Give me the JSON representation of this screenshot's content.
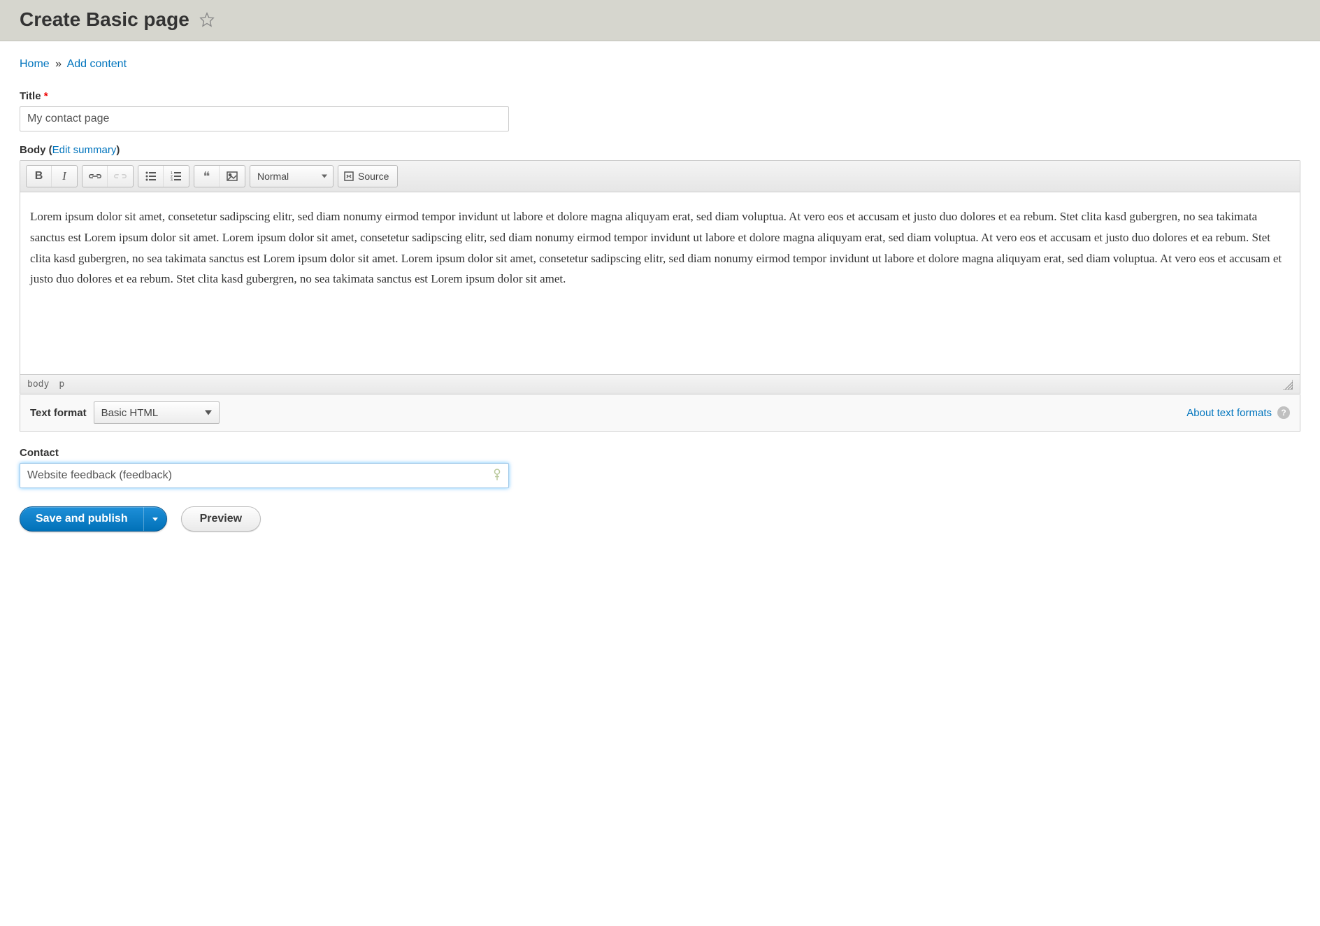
{
  "header": {
    "title": "Create Basic page"
  },
  "breadcrumb": {
    "home": "Home",
    "sep": "»",
    "add_content": "Add content"
  },
  "form": {
    "title_label": "Title",
    "required_marker": "*",
    "title_value": "My contact page",
    "body_label": "Body (",
    "edit_summary": "Edit summary",
    "body_label_close": ")",
    "contact_label": "Contact",
    "contact_value": "Website feedback (feedback)"
  },
  "toolbar": {
    "bold": "B",
    "italic": "I",
    "format_select": "Normal",
    "source": "Source"
  },
  "editor": {
    "body_text": "Lorem ipsum dolor sit amet, consetetur sadipscing elitr, sed diam nonumy eirmod tempor invidunt ut labore et dolore magna aliquyam erat, sed diam voluptua. At vero eos et accusam et justo duo dolores et ea rebum. Stet clita kasd gubergren, no sea takimata sanctus est Lorem ipsum dolor sit amet. Lorem ipsum dolor sit amet, consetetur sadipscing elitr, sed diam nonumy eirmod tempor invidunt ut labore et dolore magna aliquyam erat, sed diam voluptua. At vero eos et accusam et justo duo dolores et ea rebum. Stet clita kasd gubergren, no sea takimata sanctus est Lorem ipsum dolor sit amet. Lorem ipsum dolor sit amet, consetetur sadipscing elitr, sed diam nonumy eirmod tempor invidunt ut labore et dolore magna aliquyam erat, sed diam voluptua. At vero eos et accusam et justo duo dolores et ea rebum. Stet clita kasd gubergren, no sea takimata sanctus est Lorem ipsum dolor sit amet.",
    "path_el1": "body",
    "path_el2": "p"
  },
  "format_bar": {
    "label": "Text format",
    "selected": "Basic HTML",
    "about_link": "About text formats",
    "help": "?"
  },
  "actions": {
    "save": "Save and publish",
    "preview": "Preview"
  }
}
